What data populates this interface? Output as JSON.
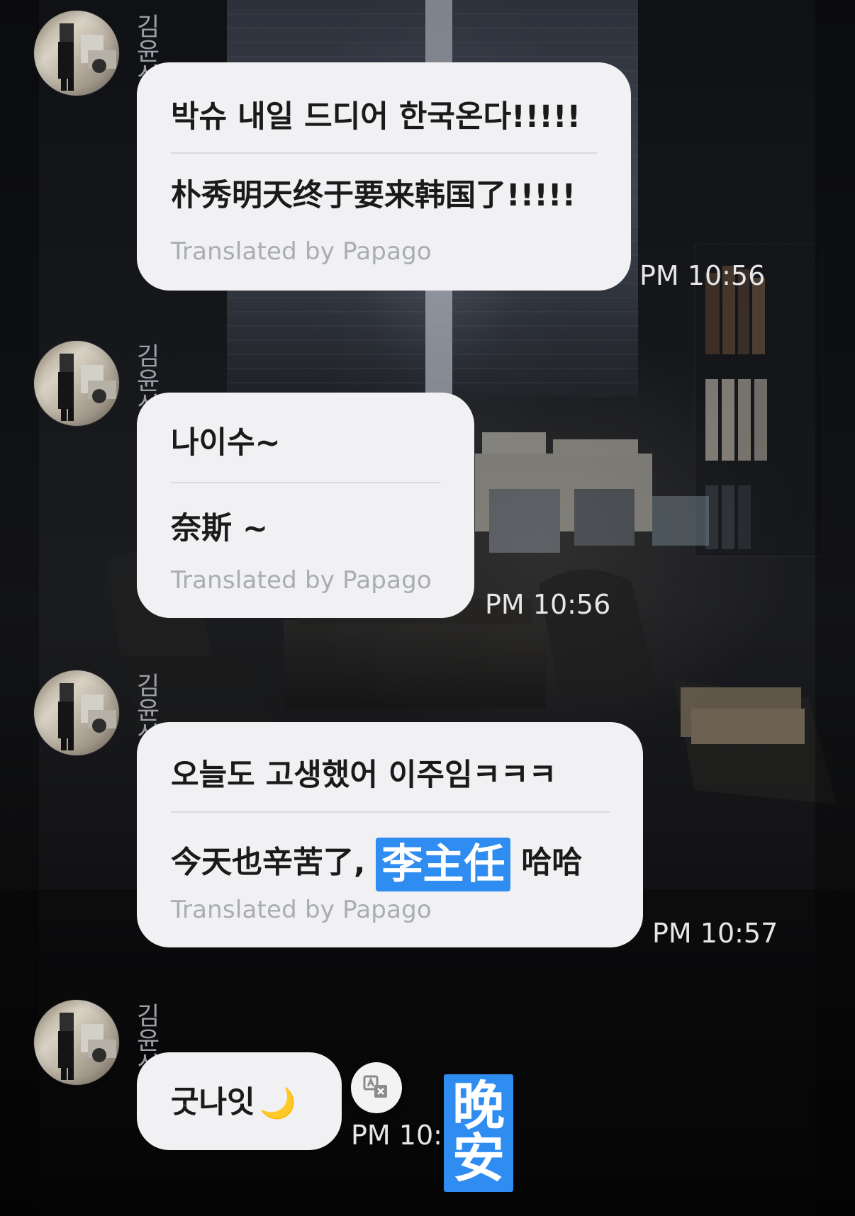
{
  "messages": [
    {
      "sender": "김윤식",
      "original": "박슈 내일 드디어 한국온다!!!!!",
      "translated": "朴秀明天终于要来韩国了!!!!!",
      "translated_by": "Translated by Papago",
      "time": "PM 10:56"
    },
    {
      "sender": "김윤식",
      "original": "나이수~",
      "translated": "奈斯 ~",
      "translated_by": "Translated by Papago",
      "time": "PM 10:56"
    },
    {
      "sender": "김윤식",
      "original": "오늘도 고생했어 이주임ㅋㅋㅋ",
      "translated_prefix": "今天也辛苦了,",
      "translated_highlight": "李主任",
      "translated_suffix": "哈哈",
      "translated_by": "Translated by Papago",
      "time": "PM 10:57"
    },
    {
      "sender": "김윤식",
      "original": "굿나잇",
      "moon": "🌙",
      "time_partial": "PM 10:",
      "overlay_translation": "晚安"
    }
  ],
  "icons": {
    "translate_button": "translate-icon",
    "avatar": "avatar-icon"
  },
  "colors": {
    "bubble": "#f1f1f4",
    "highlight": "#2f8cf0",
    "time": "#e6e6e6",
    "sender": "#9c9fa6",
    "papago": "#a8acb3"
  }
}
